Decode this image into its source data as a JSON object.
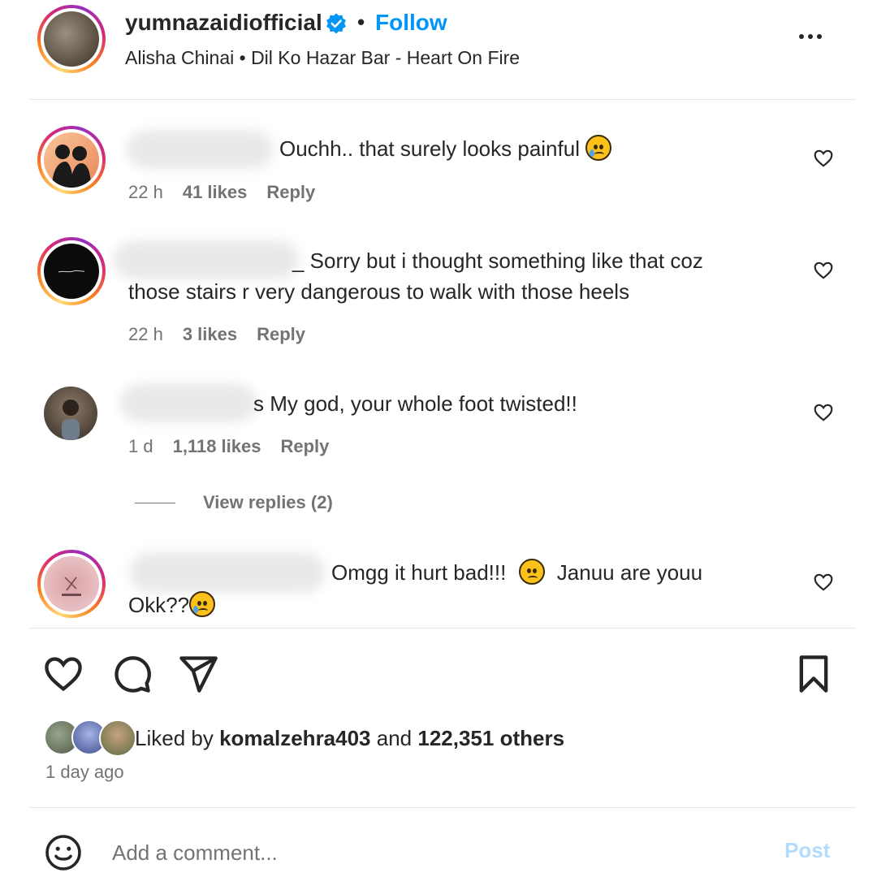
{
  "post_header": {
    "username": "yumnazaidiofficial",
    "separator": "•",
    "follow_label": "Follow",
    "audio": "Alisha Chinai • Dil Ko Hazar Bar - Heart On Fire",
    "more_icon": "more-horizontal-icon"
  },
  "comments": [
    {
      "text": "Ouchh.. that surely looks painful",
      "emoji": "sad-tear-emoji",
      "time": "22 h",
      "likes": "41 likes",
      "reply_label": "Reply"
    },
    {
      "text_line1": "_ Sorry but i thought something like that coz",
      "text_line2": "those stairs r very dangerous to walk with those heels",
      "time": "22 h",
      "likes": "3 likes",
      "reply_label": "Reply"
    },
    {
      "text": "s My god, your whole foot twisted!!",
      "time": "1 d",
      "likes": "1,118 likes",
      "reply_label": "Reply",
      "view_replies": "View replies (2)"
    },
    {
      "text_line1a": "Omgg it hurt bad!!!",
      "text_line1b": "Januu are youu",
      "text_line2": "Okk??",
      "emoji_1": "pensive-emoji",
      "emoji_2": "crying-emoji"
    }
  ],
  "actions": {
    "like_icon": "heart-icon",
    "comment_icon": "comment-icon",
    "share_icon": "send-icon",
    "save_icon": "bookmark-icon"
  },
  "likes": {
    "prefix": "Liked by ",
    "user": "komalzehra403",
    "middle": " and ",
    "count": "122,351 others"
  },
  "time_ago": "1 day ago",
  "comment_box": {
    "placeholder": "Add a comment...",
    "post_label": "Post"
  },
  "colors": {
    "accent": "#0095f6",
    "post_disabled": "#b3dbff",
    "muted": "#737373"
  }
}
